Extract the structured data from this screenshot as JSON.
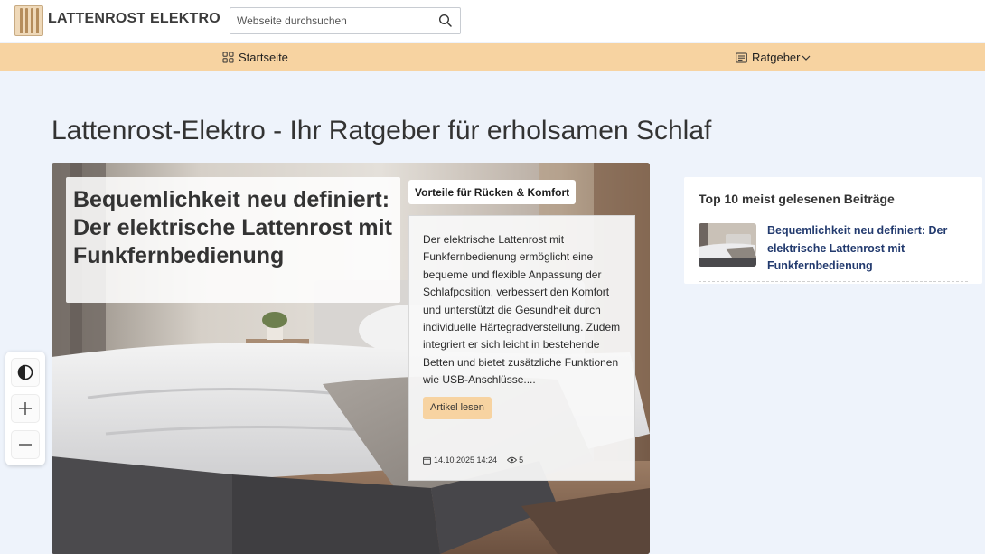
{
  "header": {
    "logo_text": "LATTENROST ELEKTRO",
    "search_placeholder": "Webseite durchsuchen"
  },
  "nav": {
    "items": [
      {
        "label": "Startseite",
        "icon": "grid-icon"
      },
      {
        "label": "Ratgeber",
        "icon": "newspaper-icon",
        "has_dropdown": true
      }
    ]
  },
  "page": {
    "title": "Lattenrost-Elektro - Ihr Ratgeber für erholsamen Schlaf"
  },
  "featured": {
    "title": "Bequemlichkeit neu definiert: Der elektrische Lattenrost mit Funkfernbedienung",
    "category": "Vorteile für Rücken & Komfort",
    "excerpt": "Der elektrische Lattenrost mit Funkfernbedienung ermöglicht eine bequeme und flexible Anpassung der Schlafposition, verbessert den Komfort und unterstützt die Gesundheit durch individuelle Härtegradverstellung. Zudem integriert er sich leicht in bestehende Betten und bietet zusätzliche Funktionen wie USB-Anschlüsse....",
    "read_more": "Artikel lesen",
    "date": "14.10.2025 14:24",
    "views": "5"
  },
  "sidebar": {
    "title": "Top 10 meist gelesenen Beiträge",
    "items": [
      {
        "title": "Bequemlichkeit neu definiert: Der elektrische Lattenrost mit Funkfernbedienung"
      }
    ]
  },
  "accessibility": {
    "buttons": [
      "contrast-icon",
      "zoom-in-icon",
      "zoom-out-icon"
    ]
  },
  "colors": {
    "nav_bg": "#f7d3a1",
    "page_bg": "#eef3fb",
    "link": "#223a6e"
  }
}
